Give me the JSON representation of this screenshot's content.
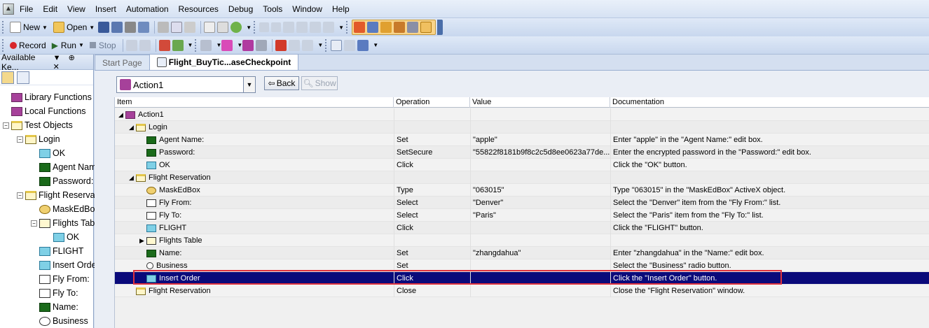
{
  "menu": [
    "File",
    "Edit",
    "View",
    "Insert",
    "Automation",
    "Resources",
    "Debug",
    "Tools",
    "Window",
    "Help"
  ],
  "toolbar": {
    "new_label": "New",
    "open_label": "Open",
    "record_label": "Record",
    "run_label": "Run",
    "stop_label": "Stop"
  },
  "left_panel": {
    "title": "Available Ke...",
    "tree": [
      {
        "label": "Library Functions",
        "level": 0
      },
      {
        "label": "Local Functions",
        "level": 0
      },
      {
        "label": "Test Objects",
        "level": 0
      },
      {
        "label": "Login",
        "level": 1
      },
      {
        "label": "OK",
        "level": 2
      },
      {
        "label": "Agent Name:",
        "level": 2
      },
      {
        "label": "Password:",
        "level": 2
      },
      {
        "label": "Flight Reservation",
        "level": 1
      },
      {
        "label": "MaskEdBox",
        "level": 2
      },
      {
        "label": "Flights Table",
        "level": 2
      },
      {
        "label": "OK",
        "level": 3
      },
      {
        "label": "FLIGHT",
        "level": 2
      },
      {
        "label": "Insert Order",
        "level": 2
      },
      {
        "label": "Fly From:",
        "level": 2
      },
      {
        "label": "Fly To:",
        "level": 2
      },
      {
        "label": "Name:",
        "level": 2
      },
      {
        "label": "Business",
        "level": 2
      }
    ]
  },
  "tabs": [
    "Start Page",
    "Flight_BuyTic...aseCheckpoint"
  ],
  "action_select": {
    "value": "Action1"
  },
  "nav": {
    "back_label": "Back",
    "show_label": "Show"
  },
  "grid": {
    "columns": [
      "Item",
      "Operation",
      "Value",
      "Documentation"
    ],
    "rows": [
      {
        "item": "Action1",
        "level": 0,
        "icon": "action-icon",
        "expander": "open",
        "operation": "",
        "value": "",
        "documentation": ""
      },
      {
        "item": "Login",
        "level": 1,
        "icon": "window-icon",
        "expander": "open",
        "operation": "",
        "value": "",
        "documentation": ""
      },
      {
        "item": "Agent Name:",
        "level": 2,
        "icon": "edit-icon",
        "expander": "",
        "operation": "Set",
        "value": "\"apple\"",
        "documentation": "Enter \"apple\" in the \"Agent Name:\" edit box."
      },
      {
        "item": "Password:",
        "level": 2,
        "icon": "edit-icon",
        "expander": "",
        "operation": "SetSecure",
        "value": "\"55822f8181b9f8c2c5d8ee0623a77de...",
        "documentation": "Enter the encrypted password in the \"Password:\" edit box."
      },
      {
        "item": "OK",
        "level": 2,
        "icon": "button-icon",
        "expander": "",
        "operation": "Click",
        "value": "",
        "documentation": "Click the \"OK\" button."
      },
      {
        "item": "Flight Reservation",
        "level": 1,
        "icon": "window-icon",
        "expander": "open",
        "operation": "",
        "value": "",
        "documentation": ""
      },
      {
        "item": "MaskEdBox",
        "level": 2,
        "icon": "activex-icon",
        "expander": "",
        "operation": "Type",
        "value": "\"063015\"",
        "documentation": "Type \"063015\" in the \"MaskEdBox\" ActiveX object."
      },
      {
        "item": "Fly From:",
        "level": 2,
        "icon": "list-icon",
        "expander": "",
        "operation": "Select",
        "value": "\"Denver\"",
        "documentation": "Select the \"Denver\" item from the \"Fly From:\" list."
      },
      {
        "item": "Fly To:",
        "level": 2,
        "icon": "list-icon",
        "expander": "",
        "operation": "Select",
        "value": "\"Paris\"",
        "documentation": "Select the \"Paris\" item from the \"Fly To:\" list."
      },
      {
        "item": "FLIGHT",
        "level": 2,
        "icon": "button-icon",
        "expander": "",
        "operation": "Click",
        "value": "",
        "documentation": "Click the \"FLIGHT\" button."
      },
      {
        "item": "Flights Table",
        "level": 2,
        "icon": "table-icon",
        "expander": "closed",
        "operation": "",
        "value": "",
        "documentation": ""
      },
      {
        "item": "Name:",
        "level": 2,
        "icon": "edit-icon",
        "expander": "",
        "operation": "Set",
        "value": "\"zhangdahua\"",
        "documentation": "Enter \"zhangdahua\" in the \"Name:\" edit box."
      },
      {
        "item": "Business",
        "level": 2,
        "icon": "radio-icon",
        "expander": "",
        "operation": "Set",
        "value": "",
        "documentation": "Select the \"Business\" radio button."
      },
      {
        "item": "Insert Order",
        "level": 2,
        "icon": "button-icon",
        "expander": "",
        "operation": "Click",
        "value": "",
        "documentation": "Click the \"Insert Order\" button.",
        "selected": true
      },
      {
        "item": "Flight Reservation",
        "level": 1,
        "icon": "window-icon",
        "expander": "",
        "operation": "Close",
        "value": "",
        "documentation": "Close the \"Flight Reservation\" window."
      }
    ]
  },
  "colors": {
    "selection": "#0a0a7a",
    "highlight_border": "#e0323c",
    "toolbar_accent": "#f8d48a"
  }
}
